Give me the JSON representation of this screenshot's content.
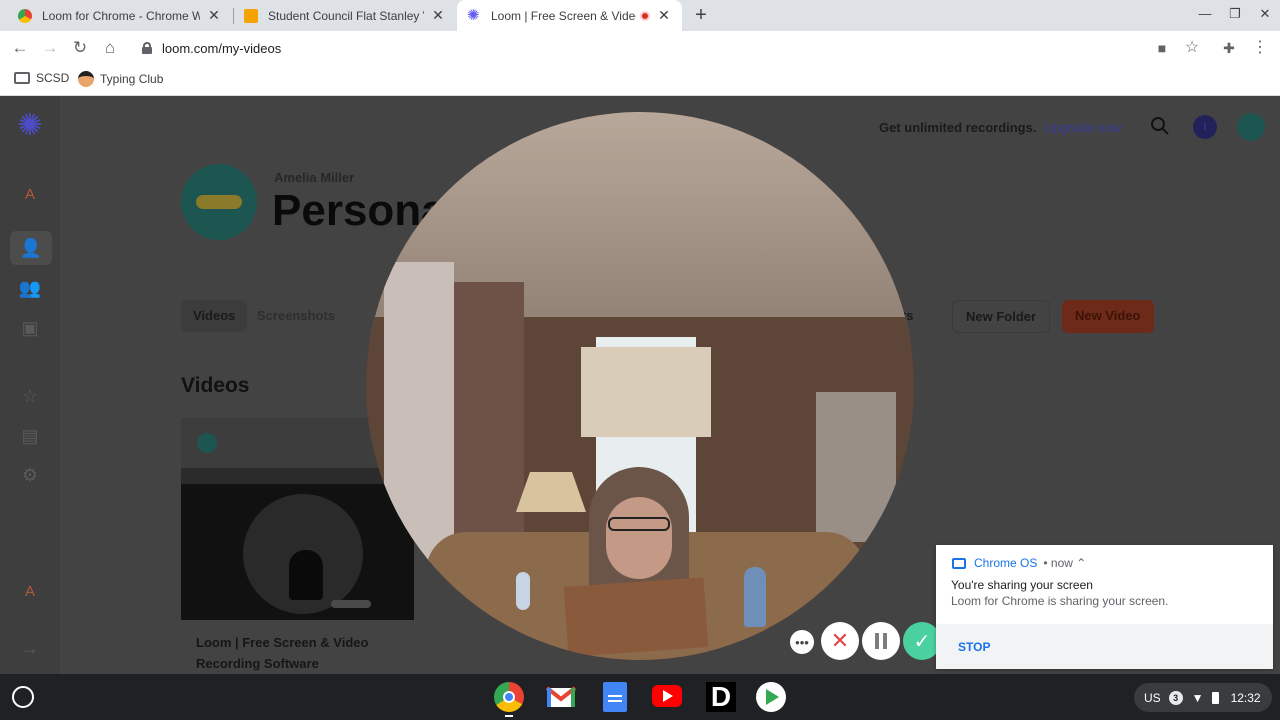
{
  "tabs": [
    {
      "title": "Loom for Chrome - Chrome Web Store"
    },
    {
      "title": "Student Council Flat Stanley Video"
    },
    {
      "title": "Loom | Free Screen & Video Recording"
    }
  ],
  "toolbar": {
    "url": "loom.com/my-videos"
  },
  "bookmarks": [
    {
      "label": "SCSD"
    },
    {
      "label": "Typing Club"
    }
  ],
  "nav": {
    "avatar_initial": "A",
    "avatar_initial_bottom": "A"
  },
  "header": {
    "promo_text": "Get unlimited recordings.",
    "upgrade_link": "Upgrade now",
    "account_initial": "I"
  },
  "workspace": {
    "owner": "Amelia Miller",
    "title": "Personal"
  },
  "content_tabs": {
    "videos": "Videos",
    "screenshots": "Screenshots"
  },
  "actions": {
    "insights": "ghts",
    "new_folder": "New Folder",
    "new_video": "New Video"
  },
  "section": {
    "title": "Videos"
  },
  "video_card": {
    "title": "Loom | Free Screen & Video Recording Software"
  },
  "notification": {
    "source": "Chrome OS",
    "meta": "• now ⌃",
    "title": "You're sharing your screen",
    "body": "Loom for Chrome is sharing your screen.",
    "action": "STOP"
  },
  "shelf": {
    "locale": "US",
    "notif_count": "3",
    "time": "12:32"
  },
  "colors": {
    "loom_purple": "#625df5",
    "record_red": "#e04848",
    "done_green": "#4bd1a0",
    "chrome_blue": "#1a73e8"
  }
}
